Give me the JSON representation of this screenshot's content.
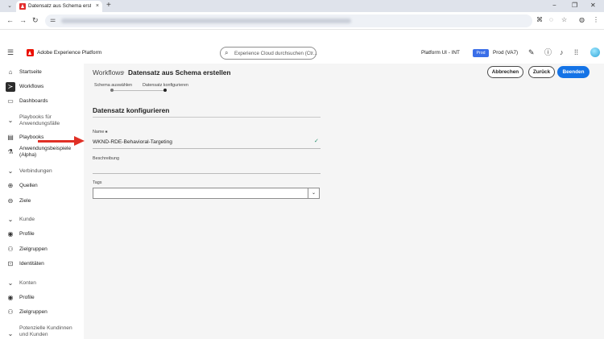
{
  "browser": {
    "tab_title": "Datensatz aus Schema erstelle",
    "tab_close": "×",
    "new_tab": "+",
    "tab_list": "⌄",
    "window_controls": [
      "−",
      "❐",
      "✕"
    ]
  },
  "header": {
    "app_name": "Adobe Experience Platform",
    "search_placeholder": "Experience Cloud durchsuchen (Ctr...",
    "org_name": "Platform UI - INT",
    "badge": "Prod",
    "sandbox": "Prod (VA7)"
  },
  "sidebar": {
    "items": [
      {
        "label": "Startseite",
        "icon": "home-icon",
        "glyph": "⌂",
        "type": "link"
      },
      {
        "label": "Workflows",
        "icon": "workflows-icon",
        "glyph": "≻",
        "type": "link",
        "active": true
      },
      {
        "label": "Dashboards",
        "icon": "dashboards-icon",
        "glyph": "▭",
        "type": "link"
      },
      {
        "label": "Playbooks für Anwendungsfälle",
        "icon": "chevron-down-icon",
        "glyph": "⌄",
        "type": "section"
      },
      {
        "label": "Playbooks",
        "icon": "playbooks-icon",
        "glyph": "▤",
        "type": "link"
      },
      {
        "label": "Anwendungsbeispiele (Alpha)",
        "icon": "flask-icon",
        "glyph": "⚗",
        "type": "link"
      },
      {
        "label": "Verbindungen",
        "icon": "chevron-down-icon",
        "glyph": "⌄",
        "type": "section"
      },
      {
        "label": "Quellen",
        "icon": "sources-icon",
        "glyph": "⊕",
        "type": "link"
      },
      {
        "label": "Ziele",
        "icon": "destinations-icon",
        "glyph": "⊖",
        "type": "link"
      },
      {
        "label": "Kunde",
        "icon": "chevron-down-icon",
        "glyph": "⌄",
        "type": "section"
      },
      {
        "label": "Profile",
        "icon": "profile-icon",
        "glyph": "◉",
        "type": "link"
      },
      {
        "label": "Zielgruppen",
        "icon": "audiences-icon",
        "glyph": "⚇",
        "type": "link"
      },
      {
        "label": "Identitäten",
        "icon": "identities-icon",
        "glyph": "⊡",
        "type": "link"
      },
      {
        "label": "Konten",
        "icon": "chevron-down-icon",
        "glyph": "⌄",
        "type": "section"
      },
      {
        "label": "Profile",
        "icon": "profile-icon",
        "glyph": "◉",
        "type": "link"
      },
      {
        "label": "Zielgruppen",
        "icon": "audiences-icon",
        "glyph": "⚇",
        "type": "link"
      },
      {
        "label": "Potenzielle Kundinnen und Kunden",
        "icon": "chevron-down-icon",
        "glyph": "⌄",
        "type": "section"
      }
    ]
  },
  "breadcrumb": {
    "parent": "Workflows",
    "current": "Datensatz aus Schema erstellen"
  },
  "actions": {
    "cancel": "Abbrechen",
    "back": "Zurück",
    "finish": "Beenden"
  },
  "steps": [
    {
      "label": "Schema auswählen",
      "current": false
    },
    {
      "label": "Datensatz konfigurieren",
      "current": true
    }
  ],
  "form": {
    "title": "Datensatz konfigurieren",
    "name_label": "Name",
    "required_mark": "✱",
    "name_value": "WKND-RDE-Behavioral-Targeting",
    "description_label": "Beschreibung",
    "tags_label": "Tags"
  },
  "colors": {
    "accent": "#1473e6",
    "adobe_red": "#eb1000",
    "annotation_arrow": "#e03026",
    "valid_check": "#268e6c"
  }
}
